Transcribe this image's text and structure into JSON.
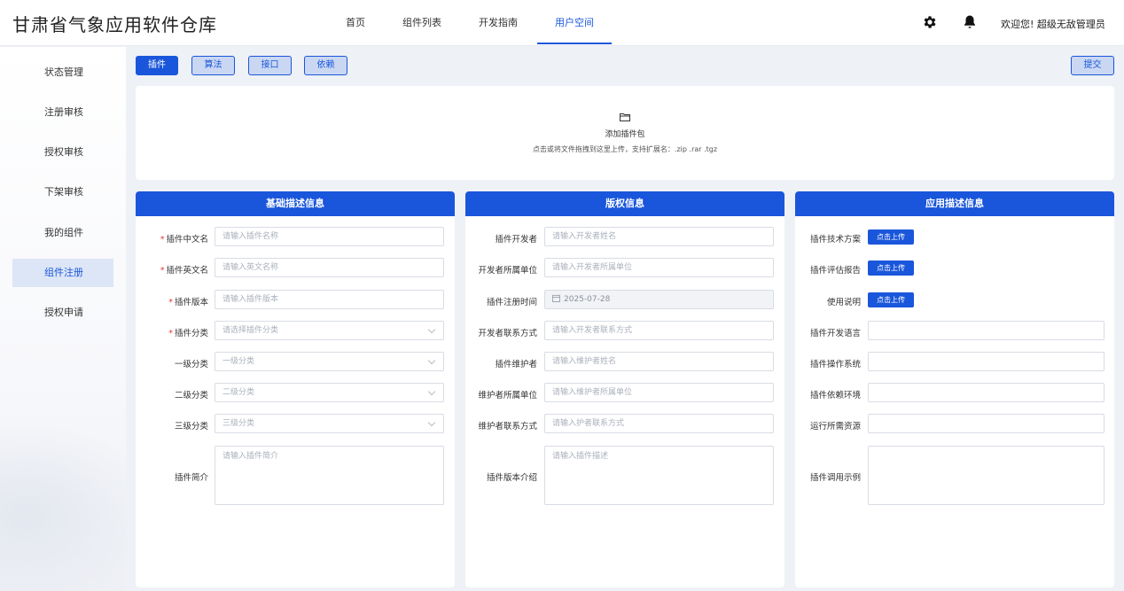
{
  "header": {
    "app_title": "甘肃省气象应用软件仓库",
    "nav": [
      "首页",
      "组件列表",
      "开发指南",
      "用户空间"
    ],
    "active_nav": "用户空间",
    "welcome": "欢迎您! 超级无敌管理员",
    "icons": [
      "gear-icon",
      "bell-icon"
    ]
  },
  "sidebar": {
    "items": [
      "状态管理",
      "注册审核",
      "授权审核",
      "下架审核",
      "我的组件",
      "组件注册",
      "授权申请"
    ],
    "active": "组件注册"
  },
  "toolbar": {
    "tabs": [
      "插件",
      "算法",
      "接口",
      "依赖"
    ],
    "active_tab": "插件",
    "submit": "提交"
  },
  "upload": {
    "icon": "folder-icon",
    "title": "添加插件包",
    "hint": "点击或将文件拖拽到这里上传，支持扩展名：.zip .rar .tgz"
  },
  "basic": {
    "title": "基础描述信息",
    "fields": [
      {
        "label": "插件中文名",
        "placeholder": "请输入插件名称",
        "required": true
      },
      {
        "label": "插件英文名",
        "placeholder": "请输入英文名称",
        "required": true
      },
      {
        "label": "插件版本",
        "placeholder": "请输入插件版本",
        "required": true
      },
      {
        "label": "插件分类",
        "placeholder": "请选择插件分类",
        "required": true
      },
      {
        "label": "一级分类",
        "placeholder": "一级分类",
        "required": false
      },
      {
        "label": "二级分类",
        "placeholder": "二级分类",
        "required": false
      },
      {
        "label": "三级分类",
        "placeholder": "三级分类",
        "required": false
      },
      {
        "label": "插件简介",
        "placeholder": "请输入插件简介",
        "required": false
      }
    ]
  },
  "copyright": {
    "title": "版权信息",
    "fields": [
      {
        "label": "插件开发者",
        "placeholder": "请输入开发者姓名"
      },
      {
        "label": "开发者所属单位",
        "placeholder": "请输入开发者所属单位"
      },
      {
        "label": "插件注册时间",
        "value": "2025-07-28"
      },
      {
        "label": "开发者联系方式",
        "placeholder": "请输入开发者联系方式"
      },
      {
        "label": "插件维护者",
        "placeholder": "请输入维护者姓名"
      },
      {
        "label": "维护者所属单位",
        "placeholder": "请输入维护者所属单位"
      },
      {
        "label": "维护者联系方式",
        "placeholder": "请输入护者联系方式"
      },
      {
        "label": "插件版本介绍",
        "placeholder": "请输入插件描述"
      }
    ]
  },
  "app_desc": {
    "title": "应用描述信息",
    "upload_label": "点击上传",
    "fields": [
      {
        "label": "插件技术方案"
      },
      {
        "label": "插件评估报告"
      },
      {
        "label": "使用说明"
      },
      {
        "label": "插件开发语言"
      },
      {
        "label": "插件操作系统"
      },
      {
        "label": "插件依赖环境"
      },
      {
        "label": "运行所需资源"
      },
      {
        "label": "插件调用示例"
      }
    ]
  },
  "colors": {
    "accent": "#1a56db",
    "required": "#e03a3a"
  }
}
